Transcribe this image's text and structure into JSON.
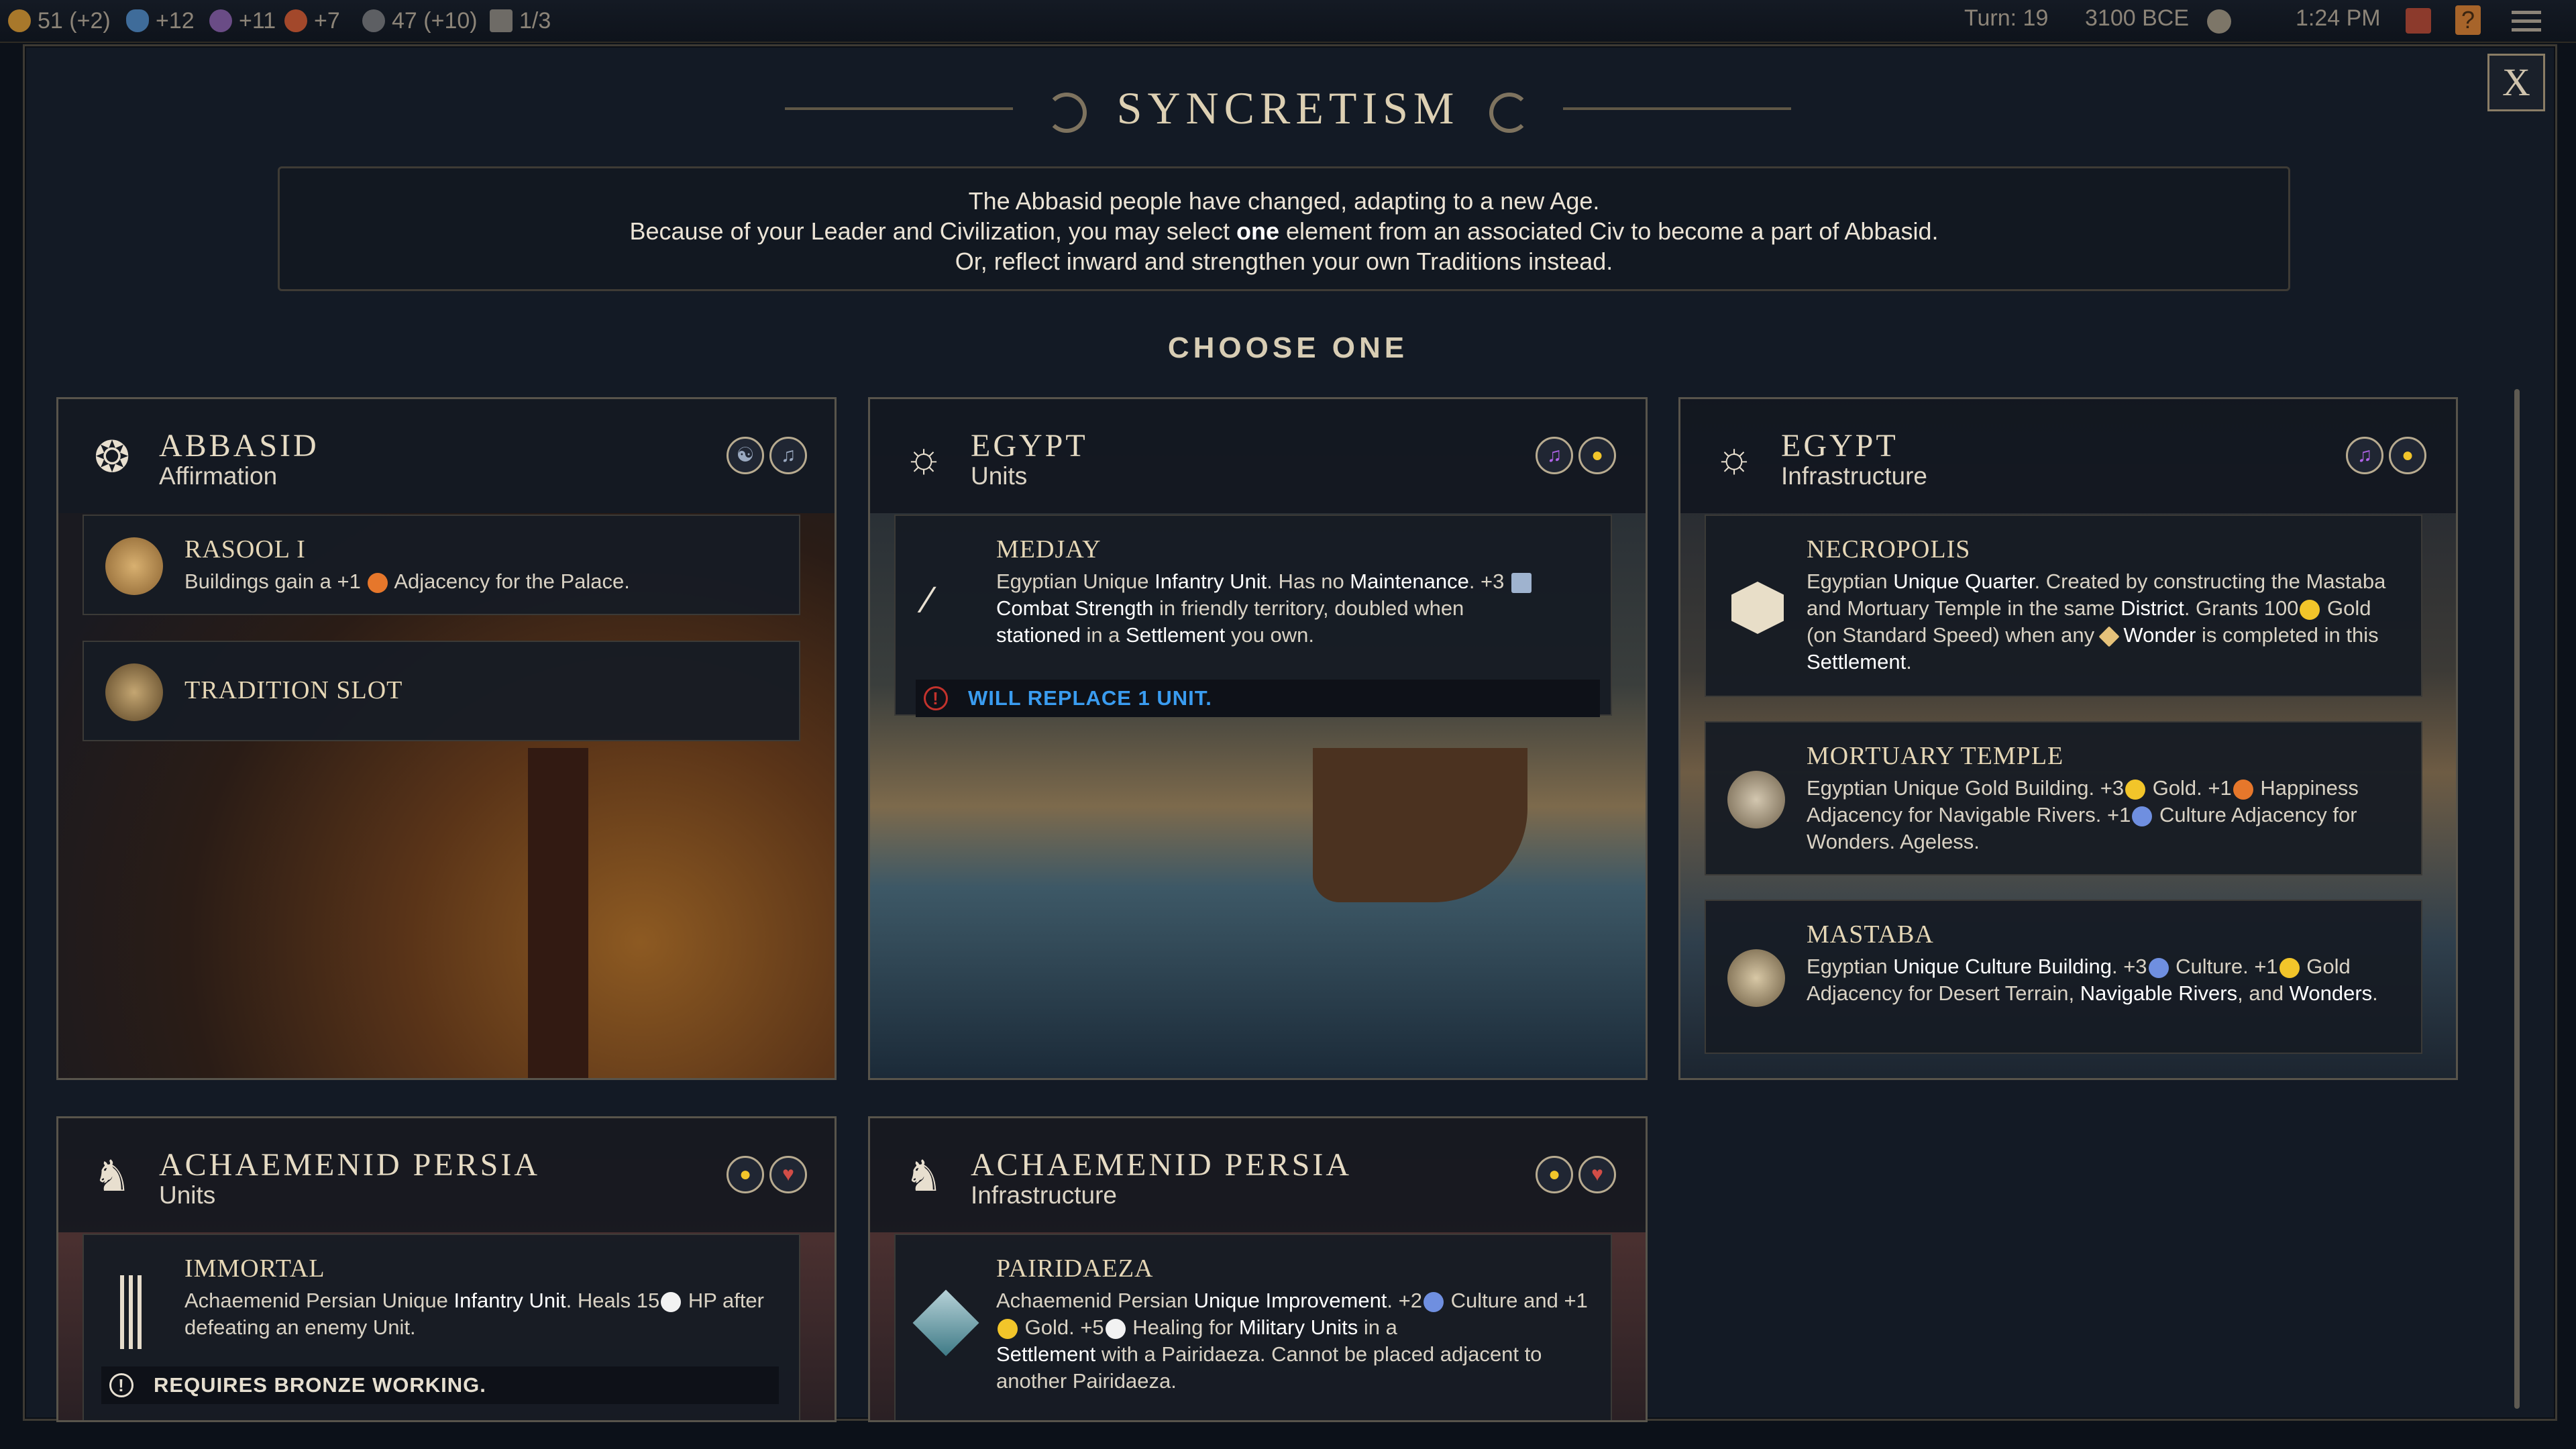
{
  "topbar": {
    "stats": [
      {
        "icon": "gold-coin-icon",
        "text": "51 (+2)"
      },
      {
        "icon": "science-flask-icon",
        "text": "+12"
      },
      {
        "icon": "culture-note-icon",
        "text": "+11"
      },
      {
        "icon": "happiness-face-icon",
        "text": "+7"
      },
      {
        "icon": "influence-globe-icon",
        "text": "47 (+10)"
      },
      {
        "icon": "settlement-icon",
        "text": "1/3"
      }
    ],
    "turn": "Turn: 19",
    "year": "3100 BCE",
    "time": "1:24 PM"
  },
  "dialog": {
    "title": "SYNCRETISM",
    "close_label": "X",
    "intro_line1": "The Abbasid people have changed, adapting to a new Age.",
    "intro_line2_a": "Because of your Leader and Civilization, you may select ",
    "intro_line2_b": "one",
    "intro_line2_c": " element from an associated Civ to become a part of Abbasid.",
    "intro_line3": "Or, reflect inward and strengthen your own Traditions instead.",
    "choose_label": "CHOOSE ONE"
  },
  "cards": {
    "abbasid": {
      "civ": "ABBASID",
      "category": "Affirmation",
      "entries": [
        {
          "name": "RASOOL I",
          "desc_a": "Buildings gain a +1 ",
          "desc_b": " Adjacency for the Palace."
        },
        {
          "name": "TRADITION SLOT"
        }
      ]
    },
    "egypt_units": {
      "civ": "EGYPT",
      "category": "Units",
      "entries": [
        {
          "name": "MEDJAY",
          "d1": "Egyptian Unique ",
          "d2": "Infantry Unit",
          "d3": ". Has no ",
          "d4": "Maintenance",
          "d5": ". +3 ",
          "d6": "Combat Strength",
          "d7": " in friendly territory, doubled when ",
          "d8": "stationed",
          "d9": " in a ",
          "d10": "Settlement",
          "d11": " you own."
        }
      ],
      "warning": "WILL REPLACE 1 UNIT."
    },
    "egypt_infra": {
      "civ": "EGYPT",
      "category": "Infrastructure",
      "entries": [
        {
          "name": "NECROPOLIS",
          "d1": "Egyptian ",
          "d2": "Unique Quarter",
          "d3": ". Created by constructing the Mastaba and Mortuary Temple in the same ",
          "d4": "District",
          "d5": ". Grants 100",
          "d6": " Gold (on Standard Speed) when any ",
          "d7": " ",
          "d8": "Wonder",
          "d9": " is completed in this ",
          "d10": "Settlement",
          "d11": "."
        },
        {
          "name": "MORTUARY TEMPLE",
          "d1": "Egyptian Unique Gold Building. +3",
          "d2": " Gold. +1",
          "d3": " Happiness Adjacency for Navigable Rivers. +1",
          "d4": " Culture Adjacency for Wonders. Ageless."
        },
        {
          "name": "MASTABA",
          "d1": "Egyptian ",
          "d2": "Unique Culture Building",
          "d3": ". +3",
          "d4": " Culture. +1",
          "d5": " Gold Adjacency for Desert Terrain, ",
          "d6": "Navigable Rivers",
          "d7": ", and ",
          "d8": "Wonders",
          "d9": "."
        }
      ]
    },
    "persia_units": {
      "civ": "ACHAEMENID PERSIA",
      "category": "Units",
      "entries": [
        {
          "name": "IMMORTAL",
          "d1": "Achaemenid Persian Unique ",
          "d2": "Infantry Unit",
          "d3": ". Heals 15",
          "d4": " HP after defeating an enemy Unit."
        }
      ],
      "warning": "REQUIRES BRONZE WORKING."
    },
    "persia_infra": {
      "civ": "ACHAEMENID PERSIA",
      "category": "Infrastructure",
      "entries": [
        {
          "name": "PAIRIDAEZA",
          "d1": "Achaemenid Persian ",
          "d2": "Unique Improvement",
          "d3": ". +2",
          "d4": " Culture and +1",
          "d5": " Gold. +5",
          "d6": " Healing for ",
          "d7": "Military Units",
          "d8": " in a ",
          "d9": "Settlement",
          "d10": " with a Pairidaeza. Cannot be placed adjacent to another Pairidaeza."
        }
      ]
    }
  },
  "colors": {
    "gold": "#f2c52a",
    "culture": "#b063e8",
    "military": "#d24d47",
    "warning_blue": "#3a9cf0",
    "title_text": "#ddd0b3"
  }
}
